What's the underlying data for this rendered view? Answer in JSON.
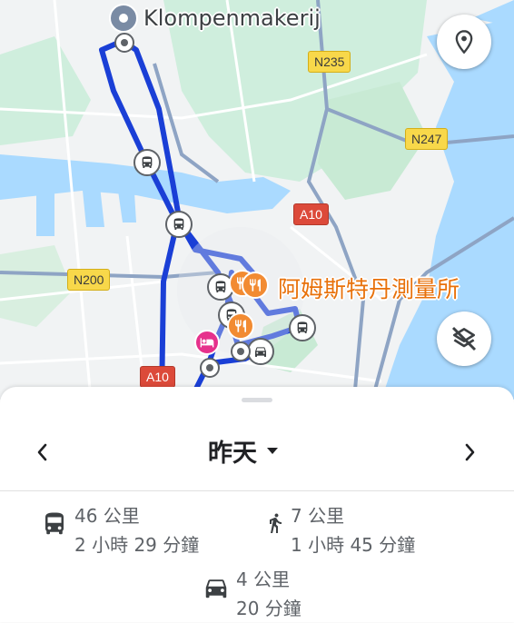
{
  "map": {
    "start_place_label": "Klompenmakerij",
    "destination_label": "阿姆斯特丹測量所",
    "road_labels": [
      "N235",
      "N247",
      "A10",
      "N200",
      "A10"
    ],
    "route_color": "#1a3fd6",
    "water_color": "#aadaff",
    "park_color": "#c8ead4",
    "land_color": "#f1f3f4",
    "food_color": "#f28b32",
    "hotel_color": "#e6318c"
  },
  "controls": {
    "location_icon": "location-pin-icon",
    "layers_icon": "layers-off-icon"
  },
  "timeline": {
    "date_label": "昨天",
    "prev_icon": "chevron-left-icon",
    "next_icon": "chevron-right-icon"
  },
  "stats": {
    "transit": {
      "distance": "46 公里",
      "duration": "2 小時 29 分鐘",
      "icon": "bus-icon"
    },
    "walk": {
      "distance": "7 公里",
      "duration": "1 小時 45 分鐘",
      "icon": "walk-icon"
    },
    "drive": {
      "distance": "4 公里",
      "duration": "20 分鐘",
      "icon": "car-icon"
    }
  }
}
